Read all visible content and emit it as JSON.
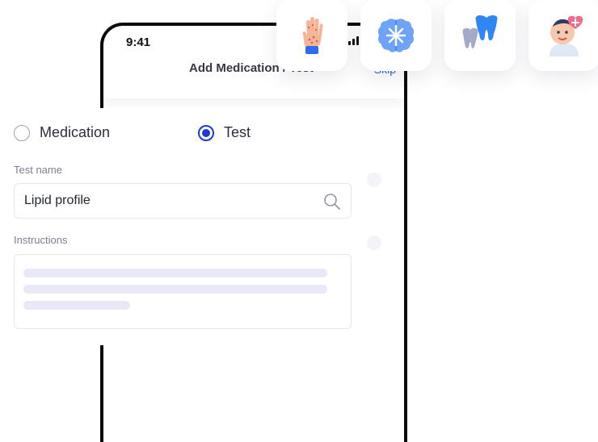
{
  "status_bar": {
    "time": "9:41"
  },
  "header": {
    "title": "Add Medication / Test",
    "skip_label": "Skip"
  },
  "category_icons": [
    {
      "name": "skin-hand-icon"
    },
    {
      "name": "brain-neurology-icon"
    },
    {
      "name": "teeth-dental-icon"
    },
    {
      "name": "baby-pediatrics-icon"
    }
  ],
  "form": {
    "type_options": [
      {
        "label": "Medication",
        "selected": false
      },
      {
        "label": "Test",
        "selected": true
      }
    ],
    "test_name_label": "Test name",
    "test_name_value": "Lipid profile",
    "instructions_label": "Instructions"
  },
  "colors": {
    "accent": "#1d3ad6",
    "link": "#2a5bd7",
    "skeleton": "#e9e8f7",
    "border": "#e6e8f0"
  }
}
